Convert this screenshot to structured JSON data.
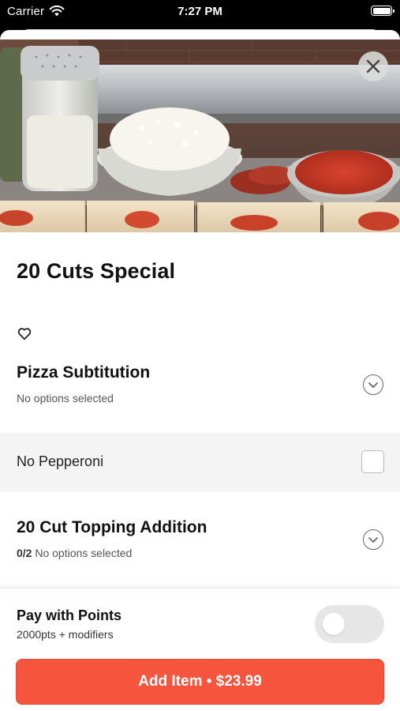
{
  "status_bar": {
    "carrier": "Carrier",
    "time": "7:27 PM"
  },
  "item": {
    "title": "20 Cuts Special"
  },
  "options": [
    {
      "title": "Pizza Subtitution",
      "count": "",
      "subtitle": "No options selected"
    },
    {
      "title": "20 Cut Topping Addition",
      "count": "0/2",
      "subtitle": "No options selected"
    }
  ],
  "modifier": {
    "label": "No Pepperoni",
    "checked": false
  },
  "points": {
    "title": "Pay with Points",
    "subtitle": "2000pts + modifiers",
    "enabled": false
  },
  "add_button": {
    "label": "Add Item • $23.99"
  },
  "colors": {
    "accent": "#f5553c"
  },
  "icons": {
    "close": "close-icon",
    "favorite": "heart-outline-icon",
    "expand": "chevron-down-icon",
    "wifi": "wifi-icon",
    "battery": "battery-icon"
  }
}
